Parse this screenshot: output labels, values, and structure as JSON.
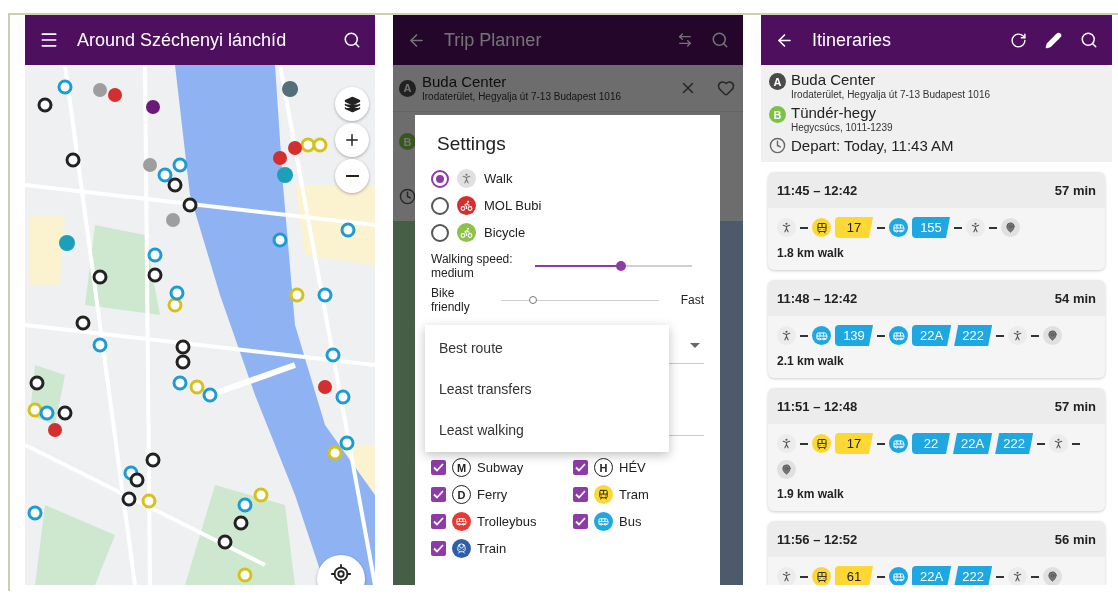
{
  "map_screen": {
    "title": "Around Széchenyi lánchíd"
  },
  "trip_planner": {
    "title": "Trip Planner",
    "from": {
      "badge": "A",
      "name": "Buda Center",
      "address": "Irodaterület, Hegyalja út 7-13 Budapest 1016"
    },
    "to": {
      "badge": "B"
    },
    "settings": {
      "title": "Settings",
      "modes": [
        {
          "label": "Walk",
          "selected": true,
          "kind": "walk",
          "color": "#e0e0e0"
        },
        {
          "label": "MOL Bubi",
          "selected": false,
          "kind": "bike",
          "color": "#d32f2f"
        },
        {
          "label": "Bicycle",
          "selected": false,
          "kind": "bike",
          "color": "#8bc34a"
        }
      ],
      "sliders": [
        {
          "label": "Walking speed: medium",
          "level": 0.55
        },
        {
          "label": "Bike friendly",
          "level": 0.2,
          "end_label": "Fast"
        }
      ],
      "route_menu": [
        "Best route",
        "Least transfers",
        "Least walking"
      ],
      "transit": [
        {
          "label": "Subway",
          "checked": true,
          "kind": "letter",
          "symbol": "M"
        },
        {
          "label": "HÉV",
          "checked": true,
          "kind": "letter",
          "symbol": "H"
        },
        {
          "label": "Ferry",
          "checked": true,
          "kind": "letter",
          "symbol": "D"
        },
        {
          "label": "Tram",
          "checked": true,
          "kind": "tram",
          "color": "#fdd835"
        },
        {
          "label": "Trolleybus",
          "checked": true,
          "kind": "trolley",
          "color": "#e53935"
        },
        {
          "label": "Bus",
          "checked": true,
          "kind": "bus",
          "color": "#1ea7e1"
        },
        {
          "label": "Train",
          "checked": true,
          "kind": "train",
          "color": "#2f5fa8"
        }
      ]
    }
  },
  "itineraries": {
    "title": "Itineraries",
    "from": {
      "badge": "A",
      "name": "Buda Center",
      "address": "Irodaterület, Hegyalja út 7-13 Budapest 1016"
    },
    "to": {
      "badge": "B",
      "name": "Tündér-hegy",
      "address": "Hegycsúcs, 1011-1239"
    },
    "depart": "Depart: Today, 11:43 AM",
    "results": [
      {
        "time": "11:45 – 12:42",
        "duration": "57 min",
        "walk": "1.8 km walk",
        "legs": [
          {
            "kind": "walk"
          },
          {
            "kind": "tram",
            "color": "#fdd835",
            "routes": [
              "17"
            ]
          },
          {
            "kind": "bus",
            "color": "#1ea7e1",
            "routes": [
              "155"
            ]
          },
          {
            "kind": "walk"
          },
          {
            "kind": "destination"
          }
        ]
      },
      {
        "time": "11:48 – 12:42",
        "duration": "54 min",
        "walk": "2.1 km walk",
        "legs": [
          {
            "kind": "walk"
          },
          {
            "kind": "bus",
            "color": "#1ea7e1",
            "routes": [
              "139"
            ]
          },
          {
            "kind": "bus",
            "color": "#1ea7e1",
            "routes": [
              "22A",
              "222"
            ]
          },
          {
            "kind": "walk"
          },
          {
            "kind": "destination"
          }
        ]
      },
      {
        "time": "11:51 – 12:48",
        "duration": "57 min",
        "walk": "1.9 km walk",
        "legs": [
          {
            "kind": "walk"
          },
          {
            "kind": "tram",
            "color": "#fdd835",
            "routes": [
              "17"
            ]
          },
          {
            "kind": "bus",
            "color": "#1ea7e1",
            "routes": [
              "22",
              "22A",
              "222"
            ]
          },
          {
            "kind": "walk"
          },
          {
            "kind": "destination"
          }
        ]
      },
      {
        "time": "11:56 – 12:52",
        "duration": "56 min",
        "legs": [
          {
            "kind": "walk"
          },
          {
            "kind": "tram",
            "color": "#fdd835",
            "routes": [
              "61"
            ]
          },
          {
            "kind": "bus",
            "color": "#1ea7e1",
            "routes": [
              "22A",
              "222"
            ]
          },
          {
            "kind": "walk"
          },
          {
            "kind": "destination"
          }
        ]
      }
    ]
  }
}
